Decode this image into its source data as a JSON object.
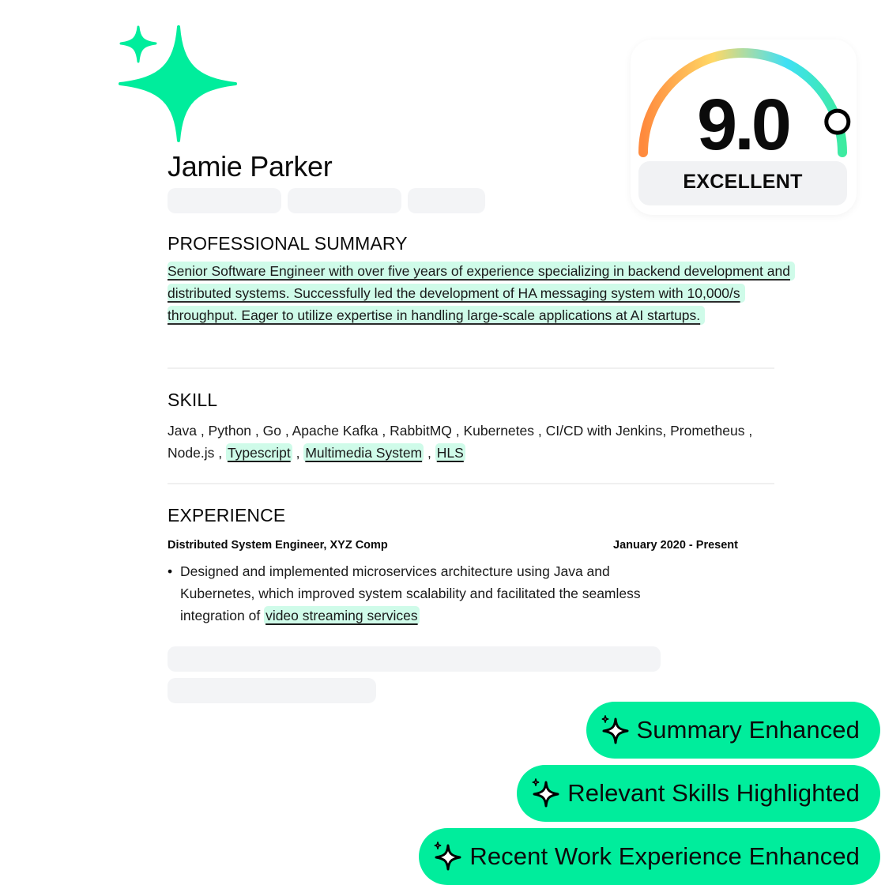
{
  "colors": {
    "accent": "#00ED9C",
    "highlight": "#CFFBE9",
    "placeholder": "#F3F4F6",
    "gauge_stops": [
      "#FF8A3D",
      "#FFD866",
      "#3FE0F5",
      "#3DEBA0"
    ]
  },
  "resume": {
    "name": "Jamie Parker",
    "summary": {
      "title": "PROFESSIONAL SUMMARY",
      "text": "Senior Software Engineer with over five years of experience specializing in backend development and distributed systems. Successfully led the development of HA messaging system with 10,000/s throughput. Eager to utilize expertise in handling large-scale applications at AI startups."
    },
    "skills": {
      "title": "SKILL",
      "plain": "Java , Python , Go , Apache Kafka , RabbitMQ , Kubernetes ,  CI/CD  with Jenkins, Prometheus , Node.js ,",
      "highlighted": [
        "Typescript",
        "Multimedia System",
        "HLS"
      ],
      "separator": ","
    },
    "experience": {
      "title": "EXPERIENCE",
      "job_title": "Distributed System Engineer, XYZ Comp",
      "dates": "January 2020 - Present",
      "bullet_marker": "•",
      "bullet_text": "Designed and implemented microservices architecture using Java and Kubernetes, which improved system scalability and facilitated the seamless integration of",
      "bullet_highlight": "video streaming services"
    }
  },
  "score": {
    "value": "9.0",
    "value_numeric": 9.0,
    "max": 10,
    "label": "EXCELLENT"
  },
  "badges": [
    {
      "icon": "sparkle-icon",
      "label": "Summary Enhanced"
    },
    {
      "icon": "sparkle-icon",
      "label": "Relevant Skills Highlighted"
    },
    {
      "icon": "sparkle-icon",
      "label": "Recent Work Experience Enhanced"
    }
  ]
}
